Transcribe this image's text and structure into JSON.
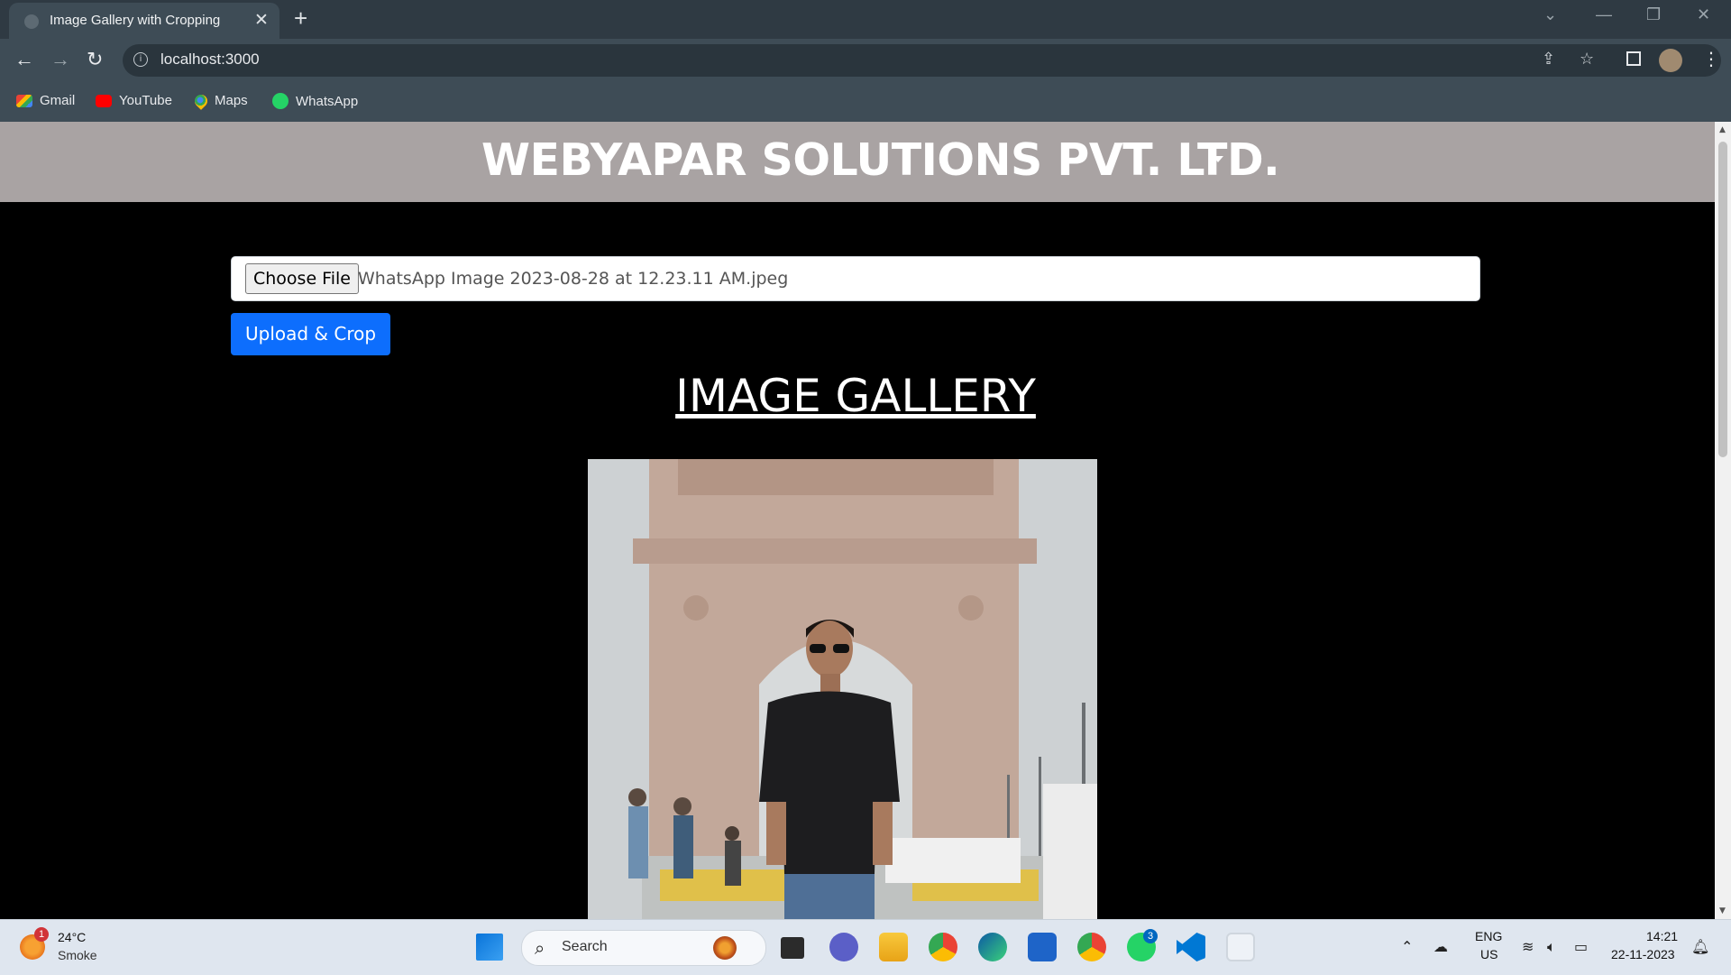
{
  "browser": {
    "tab_title": "Image Gallery with Cropping",
    "tab_close": "✕",
    "new_tab": "+",
    "url": "localhost:3000",
    "bookmarks": [
      {
        "label": "Gmail",
        "icon": "gmail-icon"
      },
      {
        "label": "YouTube",
        "icon": "youtube-icon"
      },
      {
        "label": "Maps",
        "icon": "maps-icon"
      },
      {
        "label": "WhatsApp",
        "icon": "whatsapp-icon"
      }
    ]
  },
  "page": {
    "brand": "WEBYAPAR SOLUTIONS PVT. LTD.",
    "file_input": {
      "button_label": "Choose File",
      "file_name": "WhatsApp Image 2023-08-28 at 12.23.11 AM.jpeg"
    },
    "upload_button": "Upload & Crop",
    "gallery_title": "IMAGE GALLERY"
  },
  "taskbar": {
    "weather": {
      "badge": "1",
      "temp": "24°C",
      "desc": "Smoke"
    },
    "search_placeholder": "Search",
    "whatsapp_badge": "3",
    "language": {
      "line1": "ENG",
      "line2": "US"
    },
    "time": "14:21",
    "date": "22-11-2023"
  },
  "colors": {
    "navbar": "#a9a3a3",
    "primary": "#0d6efd",
    "browser_chrome": "#3e4c56",
    "page_bg": "#000000"
  }
}
